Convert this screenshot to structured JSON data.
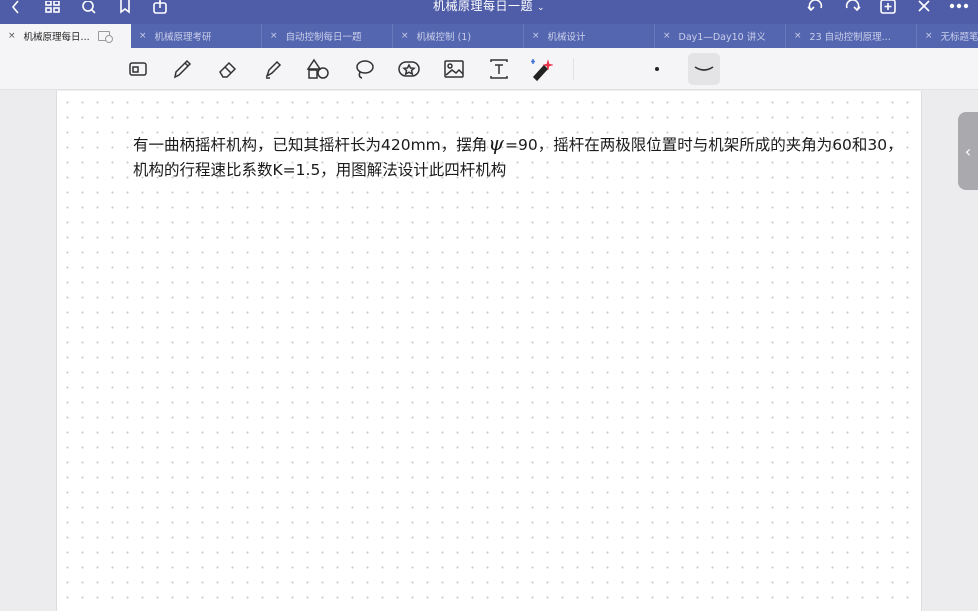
{
  "window": {
    "title": "机械原理每日一题",
    "title_chevron": "⌄"
  },
  "tabs": [
    {
      "label": "机械原理每日...",
      "active": true
    },
    {
      "label": "机械原理考研",
      "active": false
    },
    {
      "label": "自动控制每日一题",
      "active": false
    },
    {
      "label": "机械控制 (1)",
      "active": false
    },
    {
      "label": "机械设计",
      "active": false
    },
    {
      "label": "Day1—Day10 讲义",
      "active": false
    },
    {
      "label": "23 自动控制原理...",
      "active": false
    },
    {
      "label": "无标题笔",
      "active": false
    }
  ],
  "tab_close_glyph": "×",
  "titlebar_icons": [
    "back-icon",
    "grid-icon",
    "search-icon",
    "bookmark-icon",
    "share-icon",
    "undo-icon",
    "redo-icon",
    "add-page-icon",
    "close-icon",
    "more-icon"
  ],
  "toolbar_icons": [
    "read-mode-icon",
    "pen-icon",
    "eraser-icon",
    "highlighter-icon",
    "shapes-icon",
    "lasso-icon",
    "sticker-icon",
    "image-icon",
    "text-icon",
    "laser-pointer-icon"
  ],
  "document": {
    "question_part1": "有一曲柄摇杆机构，已知其摇杆长为420mm，摆角",
    "psi_symbol": "ψ",
    "question_part2": "=90，摇杆在两极限位置时与机架所成的夹角为60和30，机构的行程速比系数K=1.5，用图解法设计此四杆机构"
  },
  "colors": {
    "titlebar": "#4f5da8",
    "tabbar": "#5566b0",
    "toolbar": "#f5f5f7"
  }
}
